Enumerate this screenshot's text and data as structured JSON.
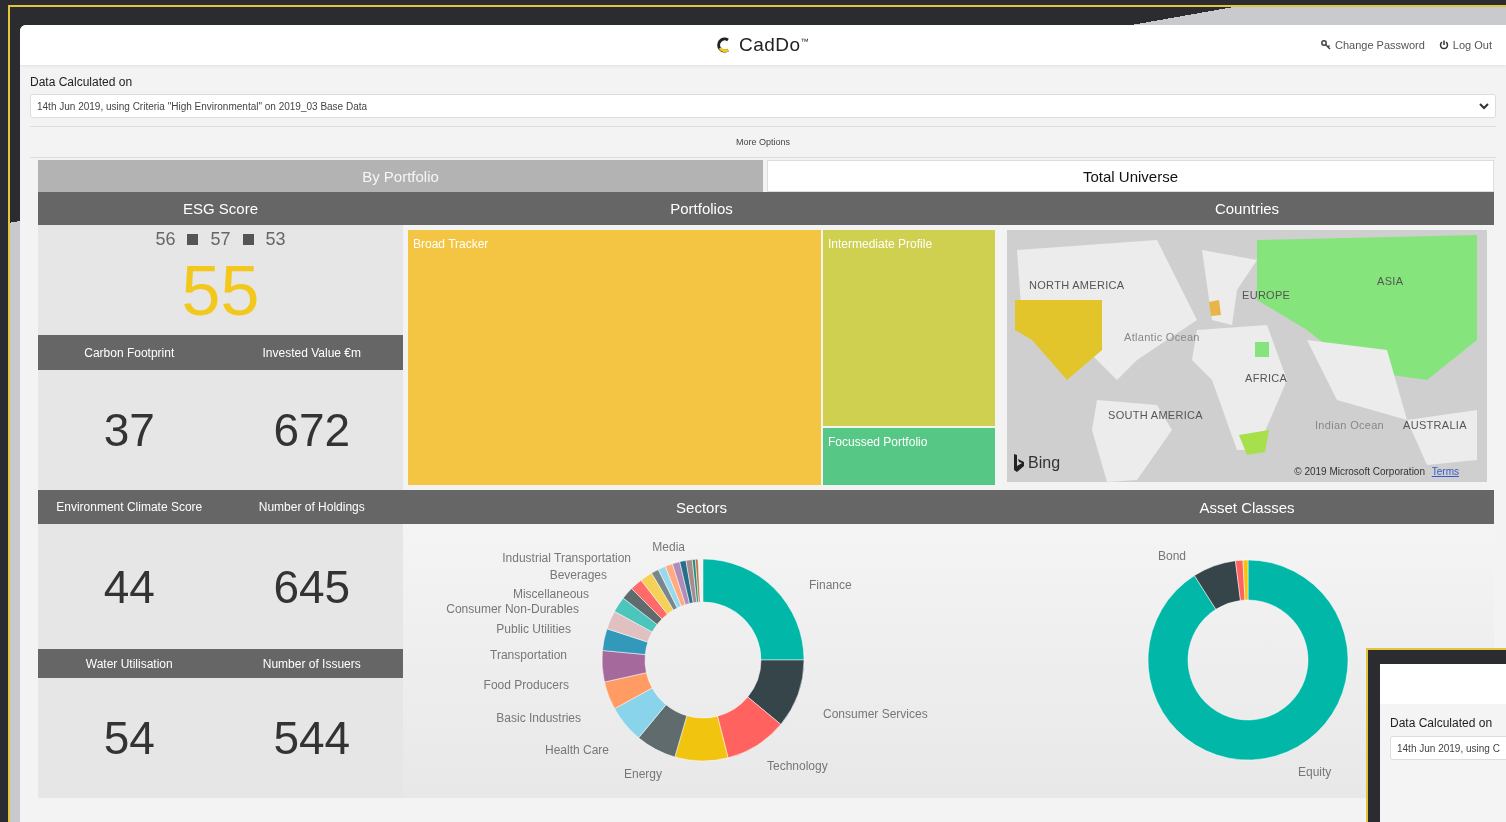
{
  "header": {
    "logo": "CadDo$^{™}$",
    "links": [
      {
        "kind": "key",
        "label": "Change Password"
      },
      {
        "kind": "power",
        "label": "Log Out"
      }
    ]
  },
  "data_calculated": {
    "label": "Data Calculated on",
    "value": "14th Jun 2019, using Criteria \"High Environmental\" on 2019_03 Base Data",
    "more_options": "More Options"
  },
  "tabs": [
    {
      "label": "By Portfolio",
      "selected": false
    },
    {
      "label": "Total Universe",
      "selected": true
    }
  ],
  "esg": {
    "title": "ESG Score",
    "scores": [
      "56",
      "57",
      "53"
    ],
    "score": "55"
  },
  "metrics": [
    {
      "label": "Carbon Footprint",
      "value": "37"
    },
    {
      "label": "Invested Value €m",
      "value": "672"
    },
    {
      "label": "Environment Climate Score",
      "value": "44"
    },
    {
      "label": "Number of Holdings",
      "value": "645"
    },
    {
      "label": "Water Utilisation",
      "value": "54"
    },
    {
      "label": "Number of Issuers",
      "value": "544"
    }
  ],
  "portfolios": {
    "title": "Portfolios",
    "items": [
      {
        "label": "Broad Tracker",
        "color": "#f4c542"
      },
      {
        "label": "Intermediate Profile",
        "color": "#cfd04f"
      },
      {
        "label": "Focussed Portfolio",
        "color": "#56c784"
      }
    ]
  },
  "countries": {
    "title": "Countries",
    "map_labels": [
      {
        "label": "NORTH AMERICA",
        "kind": "continent"
      },
      {
        "label": "EUROPE",
        "kind": "continent"
      },
      {
        "label": "ASIA",
        "kind": "continent"
      },
      {
        "label": "Atlantic Ocean",
        "kind": "ocean"
      },
      {
        "label": "AFRICA",
        "kind": "continent"
      },
      {
        "label": "SOUTH AMERICA",
        "kind": "continent"
      },
      {
        "label": "Indian Ocean",
        "kind": "ocean"
      },
      {
        "label": "AUSTRALIA",
        "kind": "continent"
      }
    ],
    "brand": "Bing",
    "copyright": "© 2019 Microsoft Corporation",
    "terms": "Terms"
  },
  "sectors": {
    "title": "Sectors",
    "labels": [
      "Media",
      "Industrial Transportation",
      "Beverages",
      "Finance",
      "Miscellaneous",
      "Consumer Non-Durables",
      "Public Utilities",
      "Transportation",
      "Food Producers",
      "Consumer Services",
      "Basic Industries",
      "Health Care",
      "Technology",
      "Energy"
    ]
  },
  "asset_classes": {
    "title": "Asset Classes",
    "labels": [
      "Bond",
      "Equity"
    ]
  },
  "inset_window": {
    "label": "Data Calculated on",
    "value": "14th Jun 2019, using C"
  }
}
